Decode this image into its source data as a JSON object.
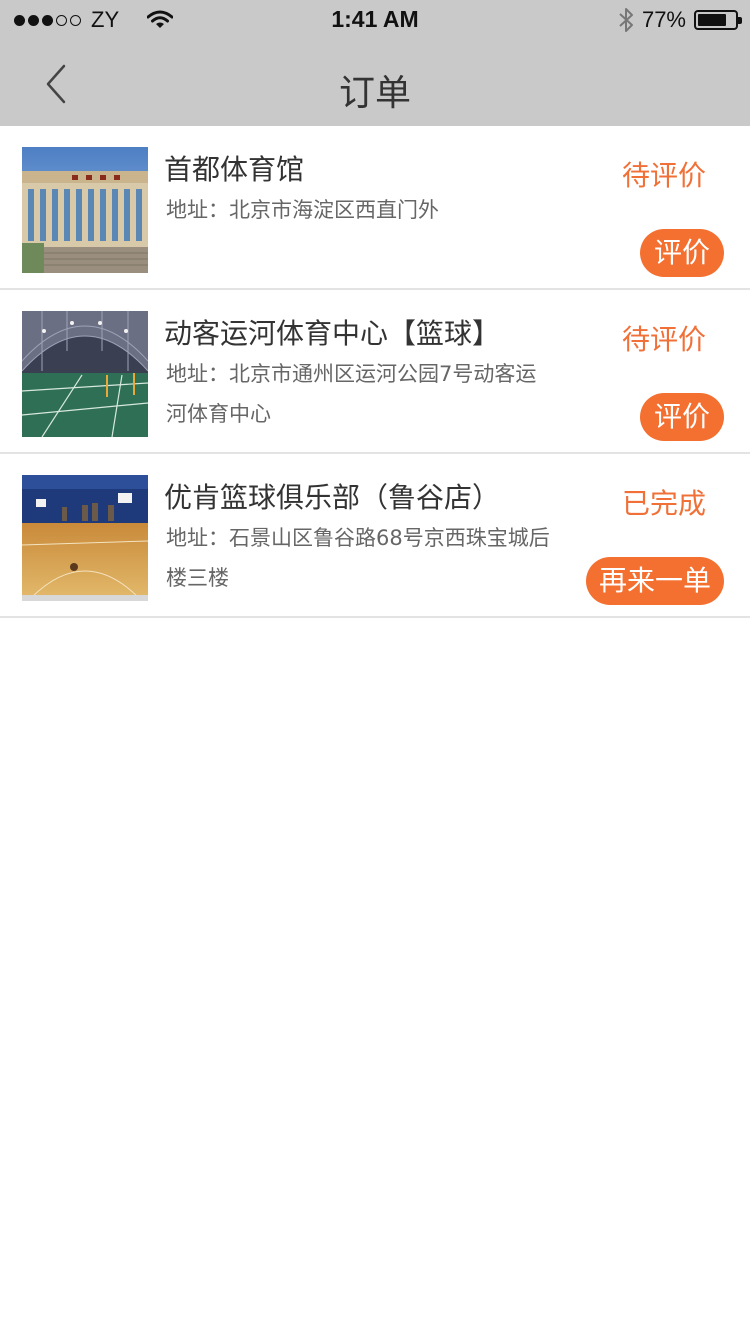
{
  "status_bar": {
    "carrier": "ZY",
    "time": "1:41 AM",
    "battery": "77%",
    "battery_level": 0.77,
    "icons": [
      "signal-dots-icon",
      "wifi-icon",
      "bluetooth-icon",
      "battery-icon"
    ]
  },
  "nav": {
    "title": "订单",
    "back_icon": "chevron-left-icon"
  },
  "orders": [
    {
      "name": "首都体育馆",
      "address": "地址：北京市海淀区西直门外",
      "status": "待评价",
      "action": "评价",
      "image": "capital-stadium-photo"
    },
    {
      "name": "动客运河体育中心【篮球】",
      "address": "地址：北京市通州区运河公园7号动客运河体育中心",
      "status": "待评价",
      "action": "评价",
      "image": "indoor-court-photo"
    },
    {
      "name": "优肯篮球俱乐部（鲁谷店）",
      "address": "地址：石景山区鲁谷路68号京西珠宝城后楼三楼",
      "status": "已完成",
      "action": "再来一单",
      "image": "basketball-court-photo"
    }
  ],
  "colors": {
    "bar_bg": "#c9c9c9",
    "accent": "#f47030",
    "status_text": "#f07038"
  }
}
